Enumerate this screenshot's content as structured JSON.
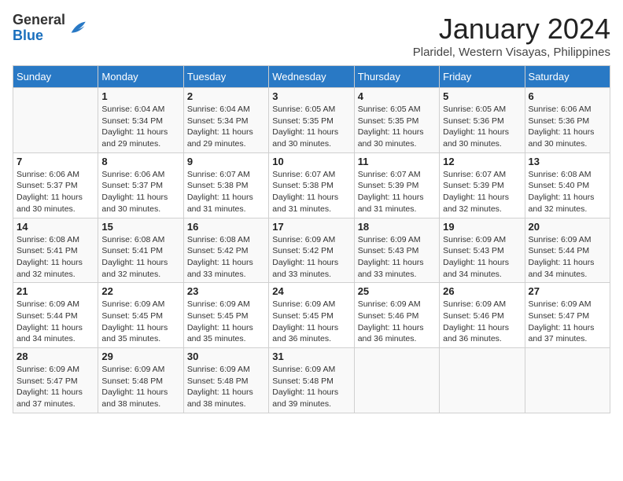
{
  "logo": {
    "text_general": "General",
    "text_blue": "Blue"
  },
  "header": {
    "month": "January 2024",
    "location": "Plaridel, Western Visayas, Philippines"
  },
  "weekdays": [
    "Sunday",
    "Monday",
    "Tuesday",
    "Wednesday",
    "Thursday",
    "Friday",
    "Saturday"
  ],
  "weeks": [
    [
      {
        "day": "",
        "sunrise": "",
        "sunset": "",
        "daylight": ""
      },
      {
        "day": "1",
        "sunrise": "Sunrise: 6:04 AM",
        "sunset": "Sunset: 5:34 PM",
        "daylight": "Daylight: 11 hours and 29 minutes."
      },
      {
        "day": "2",
        "sunrise": "Sunrise: 6:04 AM",
        "sunset": "Sunset: 5:34 PM",
        "daylight": "Daylight: 11 hours and 29 minutes."
      },
      {
        "day": "3",
        "sunrise": "Sunrise: 6:05 AM",
        "sunset": "Sunset: 5:35 PM",
        "daylight": "Daylight: 11 hours and 30 minutes."
      },
      {
        "day": "4",
        "sunrise": "Sunrise: 6:05 AM",
        "sunset": "Sunset: 5:35 PM",
        "daylight": "Daylight: 11 hours and 30 minutes."
      },
      {
        "day": "5",
        "sunrise": "Sunrise: 6:05 AM",
        "sunset": "Sunset: 5:36 PM",
        "daylight": "Daylight: 11 hours and 30 minutes."
      },
      {
        "day": "6",
        "sunrise": "Sunrise: 6:06 AM",
        "sunset": "Sunset: 5:36 PM",
        "daylight": "Daylight: 11 hours and 30 minutes."
      }
    ],
    [
      {
        "day": "7",
        "sunrise": "Sunrise: 6:06 AM",
        "sunset": "Sunset: 5:37 PM",
        "daylight": "Daylight: 11 hours and 30 minutes."
      },
      {
        "day": "8",
        "sunrise": "Sunrise: 6:06 AM",
        "sunset": "Sunset: 5:37 PM",
        "daylight": "Daylight: 11 hours and 30 minutes."
      },
      {
        "day": "9",
        "sunrise": "Sunrise: 6:07 AM",
        "sunset": "Sunset: 5:38 PM",
        "daylight": "Daylight: 11 hours and 31 minutes."
      },
      {
        "day": "10",
        "sunrise": "Sunrise: 6:07 AM",
        "sunset": "Sunset: 5:38 PM",
        "daylight": "Daylight: 11 hours and 31 minutes."
      },
      {
        "day": "11",
        "sunrise": "Sunrise: 6:07 AM",
        "sunset": "Sunset: 5:39 PM",
        "daylight": "Daylight: 11 hours and 31 minutes."
      },
      {
        "day": "12",
        "sunrise": "Sunrise: 6:07 AM",
        "sunset": "Sunset: 5:39 PM",
        "daylight": "Daylight: 11 hours and 32 minutes."
      },
      {
        "day": "13",
        "sunrise": "Sunrise: 6:08 AM",
        "sunset": "Sunset: 5:40 PM",
        "daylight": "Daylight: 11 hours and 32 minutes."
      }
    ],
    [
      {
        "day": "14",
        "sunrise": "Sunrise: 6:08 AM",
        "sunset": "Sunset: 5:41 PM",
        "daylight": "Daylight: 11 hours and 32 minutes."
      },
      {
        "day": "15",
        "sunrise": "Sunrise: 6:08 AM",
        "sunset": "Sunset: 5:41 PM",
        "daylight": "Daylight: 11 hours and 32 minutes."
      },
      {
        "day": "16",
        "sunrise": "Sunrise: 6:08 AM",
        "sunset": "Sunset: 5:42 PM",
        "daylight": "Daylight: 11 hours and 33 minutes."
      },
      {
        "day": "17",
        "sunrise": "Sunrise: 6:09 AM",
        "sunset": "Sunset: 5:42 PM",
        "daylight": "Daylight: 11 hours and 33 minutes."
      },
      {
        "day": "18",
        "sunrise": "Sunrise: 6:09 AM",
        "sunset": "Sunset: 5:43 PM",
        "daylight": "Daylight: 11 hours and 33 minutes."
      },
      {
        "day": "19",
        "sunrise": "Sunrise: 6:09 AM",
        "sunset": "Sunset: 5:43 PM",
        "daylight": "Daylight: 11 hours and 34 minutes."
      },
      {
        "day": "20",
        "sunrise": "Sunrise: 6:09 AM",
        "sunset": "Sunset: 5:44 PM",
        "daylight": "Daylight: 11 hours and 34 minutes."
      }
    ],
    [
      {
        "day": "21",
        "sunrise": "Sunrise: 6:09 AM",
        "sunset": "Sunset: 5:44 PM",
        "daylight": "Daylight: 11 hours and 34 minutes."
      },
      {
        "day": "22",
        "sunrise": "Sunrise: 6:09 AM",
        "sunset": "Sunset: 5:45 PM",
        "daylight": "Daylight: 11 hours and 35 minutes."
      },
      {
        "day": "23",
        "sunrise": "Sunrise: 6:09 AM",
        "sunset": "Sunset: 5:45 PM",
        "daylight": "Daylight: 11 hours and 35 minutes."
      },
      {
        "day": "24",
        "sunrise": "Sunrise: 6:09 AM",
        "sunset": "Sunset: 5:45 PM",
        "daylight": "Daylight: 11 hours and 36 minutes."
      },
      {
        "day": "25",
        "sunrise": "Sunrise: 6:09 AM",
        "sunset": "Sunset: 5:46 PM",
        "daylight": "Daylight: 11 hours and 36 minutes."
      },
      {
        "day": "26",
        "sunrise": "Sunrise: 6:09 AM",
        "sunset": "Sunset: 5:46 PM",
        "daylight": "Daylight: 11 hours and 36 minutes."
      },
      {
        "day": "27",
        "sunrise": "Sunrise: 6:09 AM",
        "sunset": "Sunset: 5:47 PM",
        "daylight": "Daylight: 11 hours and 37 minutes."
      }
    ],
    [
      {
        "day": "28",
        "sunrise": "Sunrise: 6:09 AM",
        "sunset": "Sunset: 5:47 PM",
        "daylight": "Daylight: 11 hours and 37 minutes."
      },
      {
        "day": "29",
        "sunrise": "Sunrise: 6:09 AM",
        "sunset": "Sunset: 5:48 PM",
        "daylight": "Daylight: 11 hours and 38 minutes."
      },
      {
        "day": "30",
        "sunrise": "Sunrise: 6:09 AM",
        "sunset": "Sunset: 5:48 PM",
        "daylight": "Daylight: 11 hours and 38 minutes."
      },
      {
        "day": "31",
        "sunrise": "Sunrise: 6:09 AM",
        "sunset": "Sunset: 5:48 PM",
        "daylight": "Daylight: 11 hours and 39 minutes."
      },
      {
        "day": "",
        "sunrise": "",
        "sunset": "",
        "daylight": ""
      },
      {
        "day": "",
        "sunrise": "",
        "sunset": "",
        "daylight": ""
      },
      {
        "day": "",
        "sunrise": "",
        "sunset": "",
        "daylight": ""
      }
    ]
  ]
}
